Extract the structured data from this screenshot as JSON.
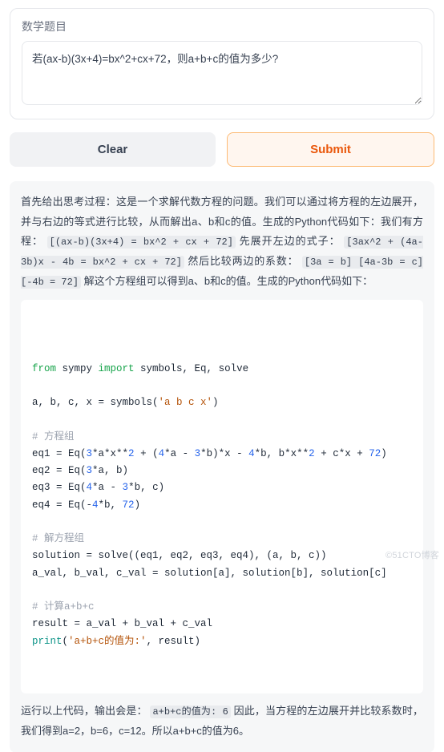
{
  "header": {
    "label": "数学题目"
  },
  "input": {
    "value": "若(ax-b)(3x+4)=bx^2+cx+72，则a+b+c的值为多少?"
  },
  "buttons": {
    "clear": "Clear",
    "submit": "Submit"
  },
  "answer": {
    "intro": "首先给出思考过程：这是一个求解代数方程的问题。我们可以通过将方程的左边展开，并与右边的等式进行比较，从而解出a、b和c的值。生成的Python代码如下：我们有方程：",
    "ihl1": "[(ax-b)(3x+4) = bx^2 + cx + 72]",
    "mid1": " 先展开左边的式子：",
    "ihl2": "[3ax^2 + (4a-3b)x - 4b = bx^2 + cx + 72]",
    "mid2": " 然后比较两边的系数：",
    "ihl3": "[3a = b] [4a-3b = c] [-4b = 72]",
    "mid3": " 解这个方程组可以得到a、b和c的值。生成的Python代码如下：",
    "outro_pre": "运行以上代码，输出会是：",
    "ihl_out": "a+b+c的值为: 6",
    "outro_post": " 因此，当方程的左边展开并比较系数时，我们得到a=2，b=6，c=12。所以a+b+c的值为6。"
  },
  "code": {
    "lines": [
      {
        "t": "code",
        "tokens": [
          {
            "k": "kw",
            "v": "from"
          },
          {
            "k": "p",
            "v": " sympy "
          },
          {
            "k": "kw",
            "v": "import"
          },
          {
            "k": "p",
            "v": " symbols, Eq, solve"
          }
        ]
      },
      {
        "t": "blank"
      },
      {
        "t": "code",
        "tokens": [
          {
            "k": "p",
            "v": "a, b, c, x = symbols("
          },
          {
            "k": "str",
            "v": "'a b c x'"
          },
          {
            "k": "p",
            "v": ")"
          }
        ]
      },
      {
        "t": "blank"
      },
      {
        "t": "com",
        "v": "# 方程组"
      },
      {
        "t": "code",
        "tokens": [
          {
            "k": "p",
            "v": "eq1 = Eq("
          },
          {
            "k": "num",
            "v": "3"
          },
          {
            "k": "p",
            "v": "*a*x**"
          },
          {
            "k": "num",
            "v": "2"
          },
          {
            "k": "p",
            "v": " + ("
          },
          {
            "k": "num",
            "v": "4"
          },
          {
            "k": "p",
            "v": "*a - "
          },
          {
            "k": "num",
            "v": "3"
          },
          {
            "k": "p",
            "v": "*b)*x - "
          },
          {
            "k": "num",
            "v": "4"
          },
          {
            "k": "p",
            "v": "*b, b*x**"
          },
          {
            "k": "num",
            "v": "2"
          },
          {
            "k": "p",
            "v": " + c*x + "
          },
          {
            "k": "num",
            "v": "72"
          },
          {
            "k": "p",
            "v": ")"
          }
        ]
      },
      {
        "t": "code",
        "tokens": [
          {
            "k": "p",
            "v": "eq2 = Eq("
          },
          {
            "k": "num",
            "v": "3"
          },
          {
            "k": "p",
            "v": "*a, b)"
          }
        ]
      },
      {
        "t": "code",
        "tokens": [
          {
            "k": "p",
            "v": "eq3 = Eq("
          },
          {
            "k": "num",
            "v": "4"
          },
          {
            "k": "p",
            "v": "*a - "
          },
          {
            "k": "num",
            "v": "3"
          },
          {
            "k": "p",
            "v": "*b, c)"
          }
        ]
      },
      {
        "t": "code",
        "tokens": [
          {
            "k": "p",
            "v": "eq4 = Eq(-"
          },
          {
            "k": "num",
            "v": "4"
          },
          {
            "k": "p",
            "v": "*b, "
          },
          {
            "k": "num",
            "v": "72"
          },
          {
            "k": "p",
            "v": ")"
          }
        ]
      },
      {
        "t": "blank"
      },
      {
        "t": "com",
        "v": "# 解方程组"
      },
      {
        "t": "code",
        "tokens": [
          {
            "k": "p",
            "v": "solution = solve((eq1, eq2, eq3, eq4), (a, b, c))"
          }
        ]
      },
      {
        "t": "code",
        "tokens": [
          {
            "k": "p",
            "v": "a_val, b_val, c_val = solution[a], solution[b], solution[c]"
          }
        ]
      },
      {
        "t": "blank"
      },
      {
        "t": "com",
        "v": "# 计算a+b+c"
      },
      {
        "t": "code",
        "tokens": [
          {
            "k": "p",
            "v": "result = a_val + b_val + c_val"
          }
        ]
      },
      {
        "t": "code",
        "tokens": [
          {
            "k": "fn",
            "v": "print"
          },
          {
            "k": "p",
            "v": "("
          },
          {
            "k": "str",
            "v": "'a+b+c的值为:'"
          },
          {
            "k": "p",
            "v": ", result)"
          }
        ]
      }
    ]
  },
  "watermark": "©51CTO博客"
}
